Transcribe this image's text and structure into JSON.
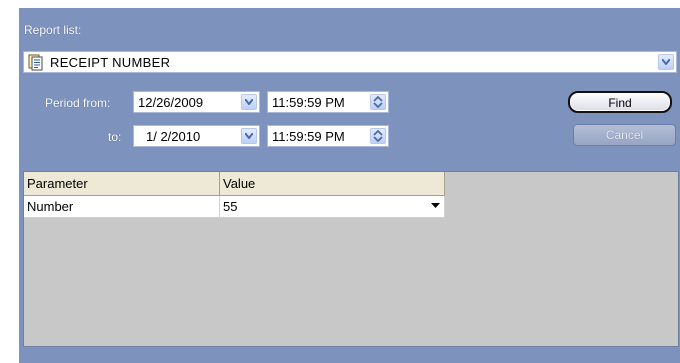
{
  "report_list": {
    "label": "Report list:",
    "selected": "RECEIPT NUMBER"
  },
  "period": {
    "from_label": "Period from:",
    "to_label": "to:",
    "from_date": "12/26/2009",
    "from_time": "11:59:59 PM",
    "to_date": "1/ 2/2010",
    "to_time": "11:59:59 PM"
  },
  "buttons": {
    "find": "Find",
    "cancel": "Cancel"
  },
  "grid": {
    "columns": [
      "Parameter",
      "Value"
    ],
    "rows": [
      {
        "parameter": "Number",
        "value": "55"
      }
    ]
  },
  "colors": {
    "panel": "#7d93bd",
    "grid_background": "#c8c8c8"
  },
  "icons": {
    "report": "document-report-icon",
    "dropdown": "chevron-down-icon",
    "spinner": "spin-up-down-icon"
  }
}
